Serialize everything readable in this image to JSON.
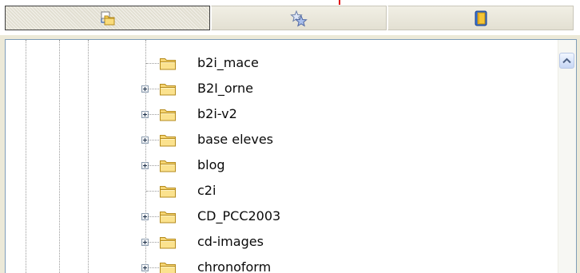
{
  "toolbar": {
    "tabs": [
      {
        "id": "folders",
        "icon": "folders-icon",
        "active": true
      },
      {
        "id": "favorites",
        "icon": "favorites-stars-icon",
        "active": false
      },
      {
        "id": "bookmarks",
        "icon": "bookmarks-book-icon",
        "active": false
      }
    ]
  },
  "tree": {
    "items": [
      {
        "label": "b2i_mace",
        "expandable": false
      },
      {
        "label": "B2I_orne",
        "expandable": true
      },
      {
        "label": "b2i-v2",
        "expandable": true
      },
      {
        "label": "base eleves",
        "expandable": true
      },
      {
        "label": "blog",
        "expandable": true
      },
      {
        "label": "c2i",
        "expandable": false
      },
      {
        "label": "CD_PCC2003",
        "expandable": true
      },
      {
        "label": "cd-images",
        "expandable": true
      },
      {
        "label": "chronoform",
        "expandable": true
      }
    ]
  },
  "scrollbar": {
    "up_arrow_icon": "chevron-up-icon"
  },
  "colors": {
    "folder_fill": "#f6d574",
    "folder_outline": "#b58b1d",
    "pane_border": "#7f9db9",
    "scroll_button": "#c6d6f5",
    "accent_mark": "#e01010"
  }
}
